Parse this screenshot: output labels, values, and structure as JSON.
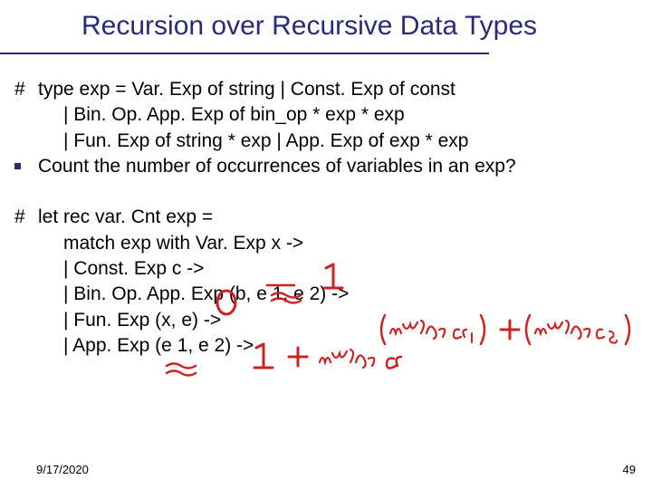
{
  "title": "Recursion over Recursive Data Types",
  "block1": {
    "marker": "#",
    "line1": "type exp = Var. Exp of string | Const. Exp of const",
    "line2": "| Bin. Op. App. Exp of bin_op * exp * exp",
    "line3": "| Fun. Exp of string * exp | App. Exp of exp * exp",
    "line4": "Count the number of occurrences of variables in an exp?"
  },
  "block2": {
    "marker": "#",
    "line1": "let rec var. Cnt exp =",
    "line2": "match exp with Var. Exp x ->",
    "line3": "| Const. Exp c ->",
    "line4": "| Bin. Op. App. Exp (b, e 1, e 2) ->",
    "line5": "| Fun. Exp (x, e) ->",
    "line6": "| App. Exp (e 1, e 2) ->"
  },
  "annotations": {
    "ans1": "1",
    "ans2": "0",
    "ans3": "(varCnt e1) + (varCnt e2)",
    "ans4": "1 + varCnt e"
  },
  "footer": {
    "date": "9/17/2020",
    "page": "49"
  }
}
